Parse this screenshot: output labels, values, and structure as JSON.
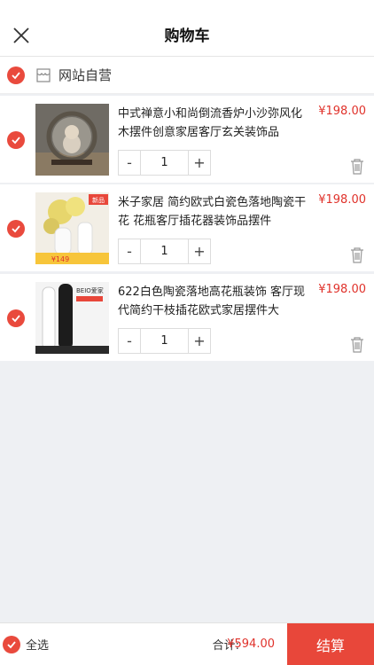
{
  "nav": {
    "title": "购物车"
  },
  "store": {
    "name": "网站自营"
  },
  "items": [
    {
      "title": "中式禅意小和尚倒流香炉小沙弥风化木摆件创意家居客厅玄关装饰品",
      "price": "¥198.00",
      "qty": "1",
      "minus": "-",
      "plus": "+"
    },
    {
      "title": "米子家居 简约欧式白瓷色落地陶瓷干花 花瓶客厅插花器装饰品摆件",
      "price": "¥198.00",
      "qty": "1",
      "minus": "-",
      "plus": "+",
      "image_badge": "¥149",
      "image_tag": "新品"
    },
    {
      "title": "622白色陶瓷落地高花瓶装饰 客厅现代简约干枝插花欧式家居摆件大",
      "price": "¥198.00",
      "qty": "1",
      "minus": "-",
      "plus": "+",
      "image_brand": "BEIO爱家"
    }
  ],
  "bottom": {
    "select_all": "全选",
    "total_label": "合计:",
    "total_value": "¥594.00",
    "checkout": "结算"
  },
  "colors": {
    "accent": "#e94a3d",
    "price": "#e0322b",
    "checkout_bg": "#e8473a"
  }
}
